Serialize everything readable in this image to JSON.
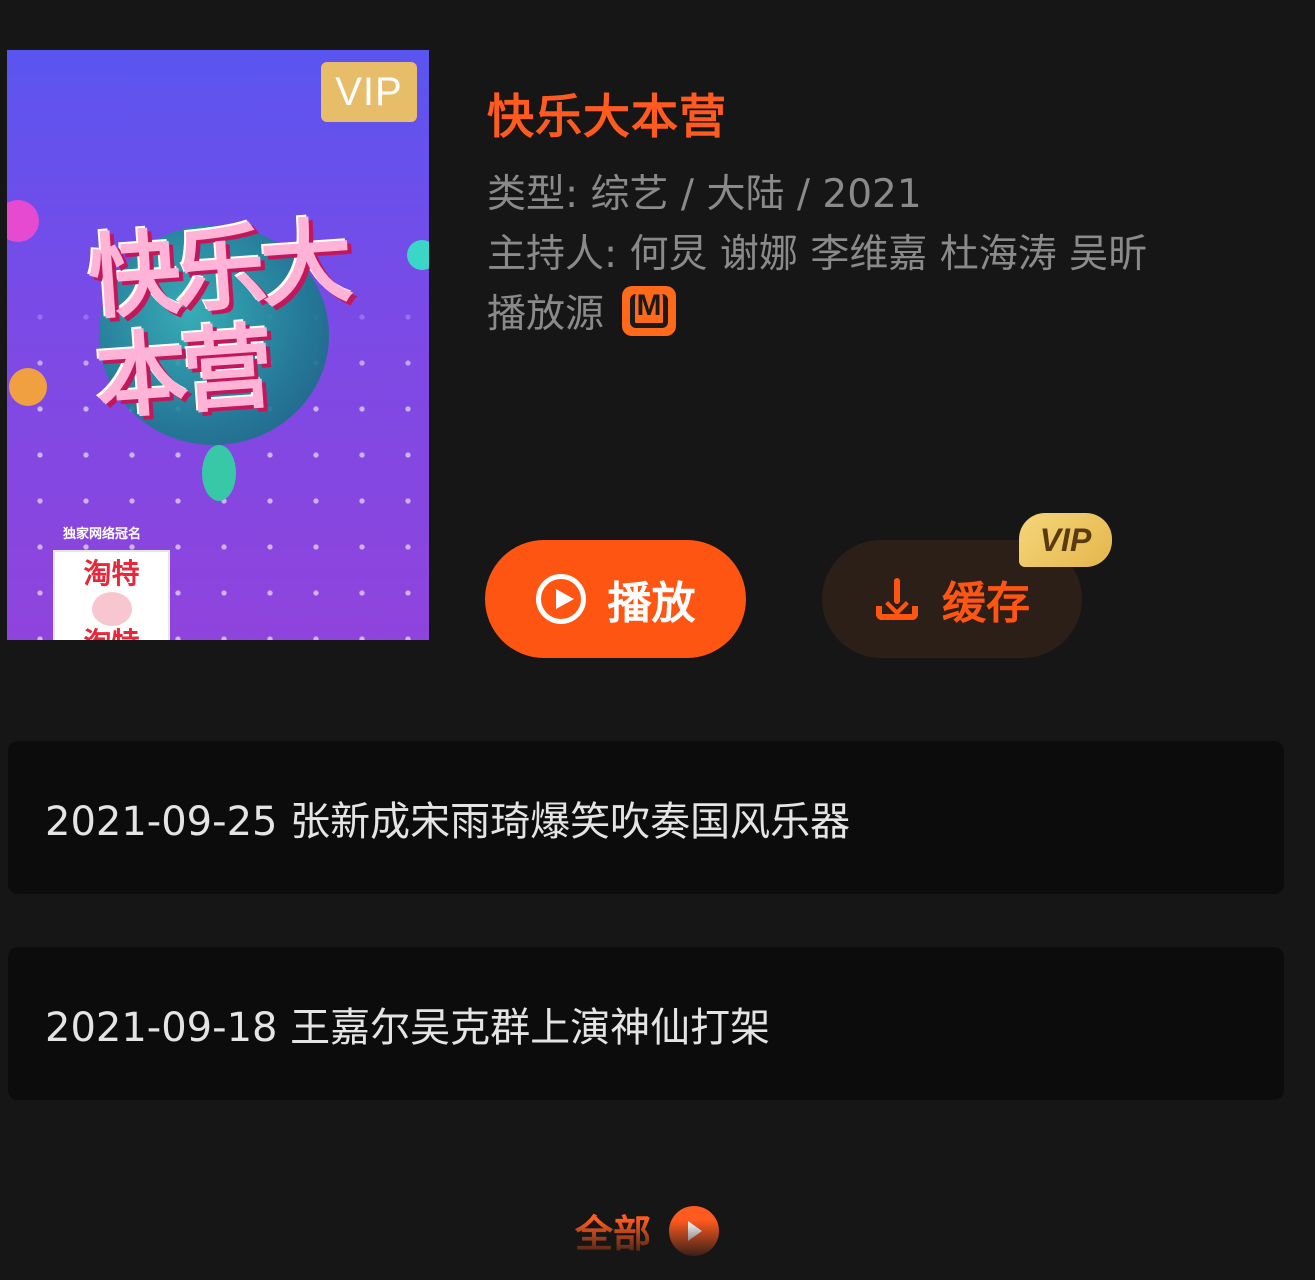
{
  "show": {
    "title": "快乐大本营",
    "genre_line": "类型: 综艺 / 大陆 / 2021",
    "hosts_line": "主持人: 何炅 谢娜 李维嘉 杜海涛 吴昕",
    "source_label": "播放源",
    "source_icon": "mango-tv-icon"
  },
  "poster": {
    "vip_tag": "VIP",
    "title_art": "快乐大本营",
    "sponsor_caption": "独家网络冠名",
    "sponsor_name_top": "淘特",
    "sponsor_name_bottom": "淘特"
  },
  "actions": {
    "play_label": "播放",
    "cache_label": "缓存",
    "cache_vip_badge": "VIP"
  },
  "episodes": [
    {
      "label": "2021-09-25 张新成宋雨琦爆笑吹奏国风乐器"
    },
    {
      "label": "2021-09-18 王嘉尔吴克群上演神仙打架"
    }
  ],
  "footer": {
    "all_label": "全部"
  },
  "colors": {
    "accent": "#ff5512",
    "title": "#ff5a1f",
    "background": "#161616",
    "card": "#0c0c0c",
    "meta_text": "#8a8a8a",
    "vip_gold": "#e8bd6a"
  }
}
